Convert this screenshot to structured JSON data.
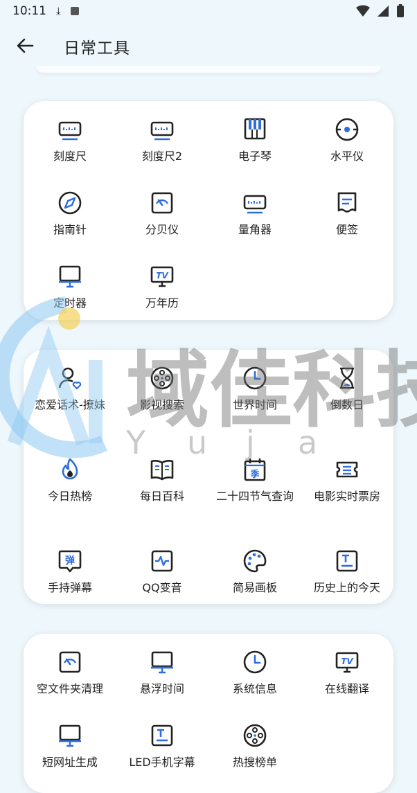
{
  "status_bar": {
    "time": "10:11"
  },
  "app_bar": {
    "title": "日常工具"
  },
  "sections": [
    {
      "items": [
        {
          "label": "刻度尺",
          "icon": "ruler-icon"
        },
        {
          "label": "刻度尺2",
          "icon": "ruler-icon"
        },
        {
          "label": "电子琴",
          "icon": "piano-icon"
        },
        {
          "label": "水平仪",
          "icon": "level-icon"
        },
        {
          "label": "指南针",
          "icon": "compass-icon"
        },
        {
          "label": "分贝仪",
          "icon": "gauge-icon"
        },
        {
          "label": "量角器",
          "icon": "ruler-icon"
        },
        {
          "label": "便签",
          "icon": "note-icon"
        },
        {
          "label": "定时器",
          "icon": "monitor-icon"
        },
        {
          "label": "万年历",
          "icon": "tv-icon"
        }
      ]
    },
    {
      "items": [
        {
          "label": "恋爱话术-撩妹",
          "icon": "user-heart-icon"
        },
        {
          "label": "影视搜索",
          "icon": "film-reel-icon"
        },
        {
          "label": "世界时间",
          "icon": "clock-icon"
        },
        {
          "label": "倒数日",
          "icon": "hourglass-icon"
        },
        {
          "label": "今日热榜",
          "icon": "flame-icon"
        },
        {
          "label": "每日百科",
          "icon": "book-icon"
        },
        {
          "label": "二十四节气查询",
          "icon": "season-calendar-icon"
        },
        {
          "label": "电影实时票房",
          "icon": "ticket-icon"
        },
        {
          "label": "手持弹幕",
          "icon": "danmu-icon"
        },
        {
          "label": "QQ变音",
          "icon": "waveform-icon"
        },
        {
          "label": "简易画板",
          "icon": "palette-icon"
        },
        {
          "label": "历史上的今天",
          "icon": "text-box-icon"
        }
      ]
    },
    {
      "items": [
        {
          "label": "空文件夹清理",
          "icon": "gauge-icon"
        },
        {
          "label": "悬浮时间",
          "icon": "monitor-icon"
        },
        {
          "label": "系统信息",
          "icon": "clock-icon"
        },
        {
          "label": "在线翻译",
          "icon": "tv-icon"
        },
        {
          "label": "短网址生成",
          "icon": "monitor-icon"
        },
        {
          "label": "LED手机字幕",
          "icon": "text-box-icon"
        },
        {
          "label": "热搜榜单",
          "icon": "film-reel-icon"
        }
      ]
    }
  ],
  "season_char": "季",
  "danmu_char": "弹",
  "watermark": {
    "brand": "域佳科技",
    "latin": [
      "Y",
      "u",
      "j",
      "a"
    ]
  },
  "colors": {
    "accent": "#2e6de0",
    "dark": "#222222",
    "background": "#eef7fc"
  }
}
